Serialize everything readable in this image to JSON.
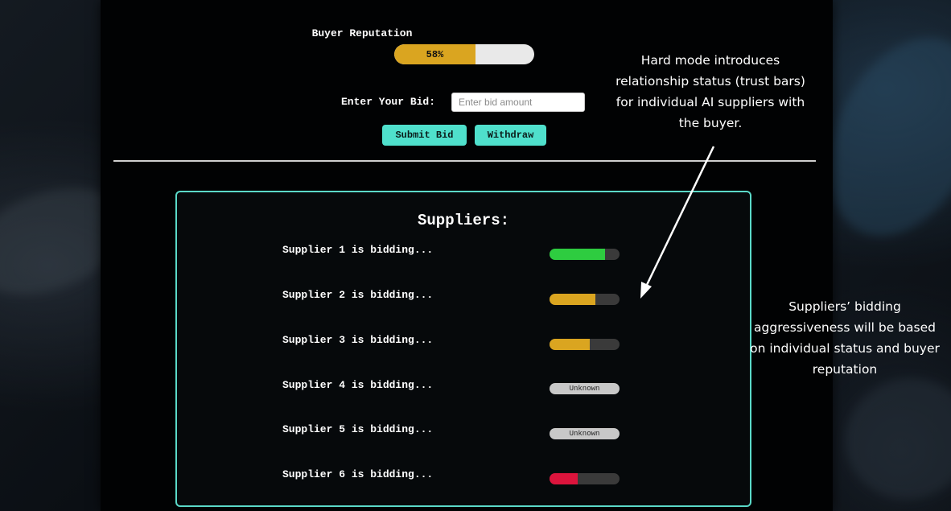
{
  "reputation": {
    "label": "Buyer Reputation",
    "value_text": "58%",
    "fraction": 0.58,
    "color": "#daa520"
  },
  "bid": {
    "label": "Enter Your Bid:",
    "placeholder": "Enter bid amount",
    "value": ""
  },
  "buttons": {
    "submit_label": "Submit Bid",
    "withdraw_label": "Withdraw",
    "color": "#4fe0cc"
  },
  "suppliers": {
    "title": "Suppliers:",
    "items": [
      {
        "text": "Supplier 1 is bidding...",
        "trust": 0.79,
        "color": "#2ecc40",
        "status": ""
      },
      {
        "text": "Supplier 2 is bidding...",
        "trust": 0.65,
        "color": "#daa520",
        "status": ""
      },
      {
        "text": "Supplier 3 is bidding...",
        "trust": 0.57,
        "color": "#daa520",
        "status": ""
      },
      {
        "text": "Supplier 4 is bidding...",
        "trust": null,
        "color": "#c8c8c8",
        "status": "Unknown"
      },
      {
        "text": "Supplier 5 is bidding...",
        "trust": null,
        "color": "#c8c8c8",
        "status": "Unknown"
      },
      {
        "text": "Supplier 6 is bidding...",
        "trust": 0.4,
        "color": "#dc143c",
        "status": ""
      }
    ]
  },
  "annotations": {
    "hard_mode": "Hard mode introduces relationship status (trust bars) for individual AI suppliers with the buyer.",
    "aggressiveness": "Suppliers’ bidding aggressiveness will be based on individual status and buyer reputation"
  }
}
